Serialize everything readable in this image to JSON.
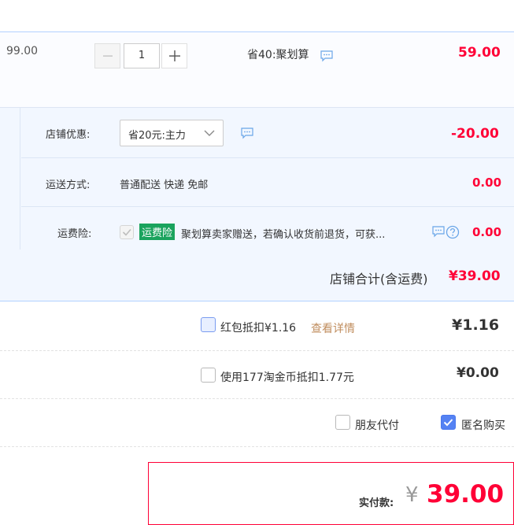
{
  "product": {
    "unit_price_partial": "99.00",
    "quantity": "1",
    "promo_text": "省40:聚划算",
    "subtotal": "59.00"
  },
  "shop": {
    "discount_label": "店铺优惠:",
    "discount_selected": "省20元:主力",
    "discount_amount": "-20.00",
    "shipping_label": "运送方式:",
    "shipping_value": "普通配送 快递 免邮",
    "shipping_amount": "0.00",
    "insurance_label": "运费险:",
    "insurance_tag": "运费险",
    "insurance_desc": "聚划算卖家赠送，若确认收货前退货，可获...",
    "insurance_amount": "0.00",
    "total_label": "店铺合计(含运费)",
    "total_amount": "¥39.00"
  },
  "options": {
    "redpacket_label": "红包抵扣¥1.16",
    "redpacket_link": "查看详情",
    "redpacket_amount": "¥1.16",
    "coins_label": "使用177淘金币抵扣1.77元",
    "coins_amount": "¥0.00",
    "friend_pay_label": "朋友代付",
    "anonymous_label": "匿名购买"
  },
  "payment": {
    "label": "实付款:",
    "currency": "¥",
    "amount": "39.00"
  },
  "colors": {
    "price_red": "#ff0036",
    "accent_blue": "#5582f3",
    "insurance_green": "#1aa35d",
    "link_brown": "#c08d5e"
  }
}
